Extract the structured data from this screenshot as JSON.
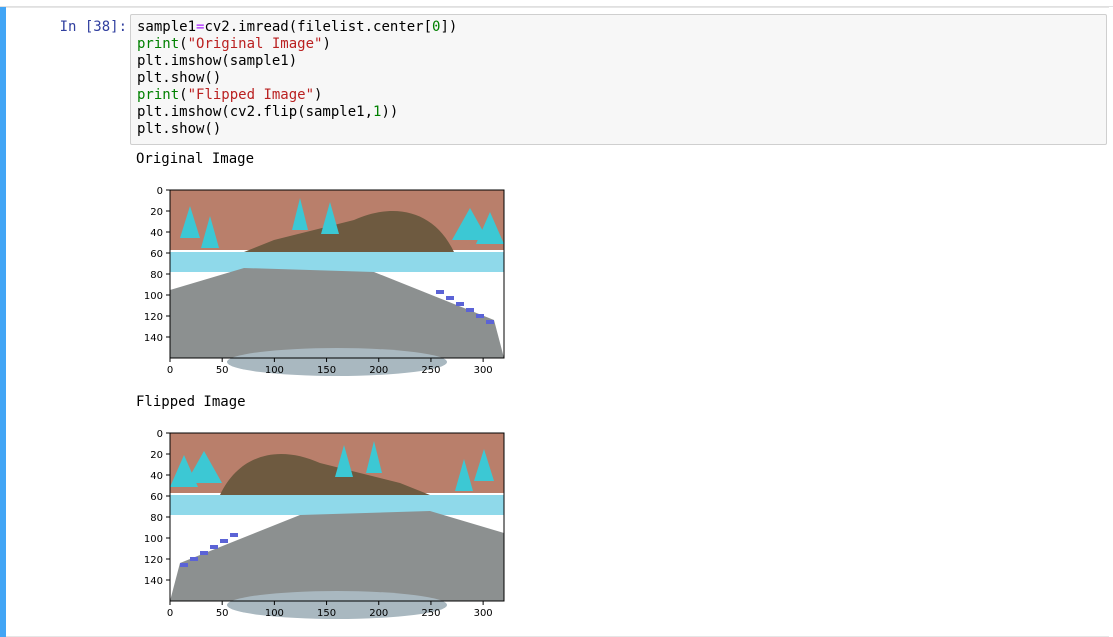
{
  "cell": {
    "prompt": "In [38]:",
    "code_lines": [
      [
        {
          "t": "sample1"
        },
        {
          "t": "=",
          "c": "op"
        },
        {
          "t": "cv2.imread(filelist.center["
        },
        {
          "t": "0",
          "c": "num"
        },
        {
          "t": "])"
        }
      ],
      [
        {
          "t": "print",
          "c": "kw"
        },
        {
          "t": "("
        },
        {
          "t": "\"Original Image\"",
          "c": "str"
        },
        {
          "t": ")"
        }
      ],
      [
        {
          "t": "plt.imshow(sample1)"
        }
      ],
      [
        {
          "t": "plt.show()"
        }
      ],
      [
        {
          "t": "print",
          "c": "kw"
        },
        {
          "t": "("
        },
        {
          "t": "\"Flipped Image\"",
          "c": "str"
        },
        {
          "t": ")"
        }
      ],
      [
        {
          "t": "plt.imshow(cv2.flip(sample1,"
        },
        {
          "t": "1",
          "c": "num"
        },
        {
          "t": "))"
        }
      ],
      [
        {
          "t": "plt.show()"
        }
      ]
    ]
  },
  "outputs": {
    "original_label": "Original Image",
    "flipped_label": "Flipped Image"
  },
  "plots": {
    "x_ticks": [
      "0",
      "50",
      "100",
      "150",
      "200",
      "250",
      "300"
    ],
    "y_ticks": [
      "0",
      "20",
      "40",
      "60",
      "80",
      "100",
      "120",
      "140"
    ],
    "x_values": [
      0,
      50,
      100,
      150,
      200,
      250,
      300
    ],
    "y_values": [
      0,
      20,
      40,
      60,
      80,
      100,
      120,
      140
    ],
    "x_max": 320,
    "y_max": 160
  },
  "colors": {
    "sky": "#b97f6b",
    "hill": "#6e5a40",
    "trees": "#3cc8d4",
    "road": "#8c9090",
    "snow": "#8fd9ea",
    "stripe": "#5b63d6",
    "hood": "#a9b8c0"
  }
}
